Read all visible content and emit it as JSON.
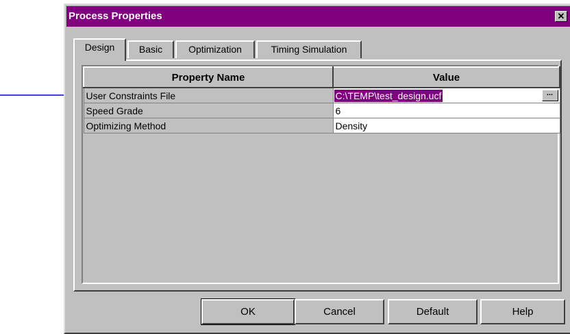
{
  "window": {
    "title": "Process Properties",
    "close_glyph": "✕"
  },
  "tabs": [
    {
      "label": "Design",
      "active": true
    },
    {
      "label": "Basic",
      "active": false
    },
    {
      "label": "Optimization",
      "active": false
    },
    {
      "label": "Timing Simulation",
      "active": false
    }
  ],
  "grid": {
    "headers": {
      "name": "Property Name",
      "value": "Value"
    },
    "rows": [
      {
        "name": "User Constraints File",
        "value": "C:\\TEMP\\test_design.ucf",
        "editing": true
      },
      {
        "name": "Speed Grade",
        "value": "6",
        "editing": false
      },
      {
        "name": "Optimizing Method",
        "value": "Density",
        "editing": false
      }
    ],
    "browse_label": "..."
  },
  "buttons": {
    "ok": "OK",
    "cancel": "Cancel",
    "default": "Default",
    "help": "Help"
  },
  "colors": {
    "titlebar": "#800080",
    "face": "#c0c0c0",
    "selection": "#800080",
    "arrow": "#0000cc"
  },
  "icons": {
    "close": "close-icon",
    "browse": "ellipsis-icon",
    "annotation": "arrow-right-icon"
  }
}
